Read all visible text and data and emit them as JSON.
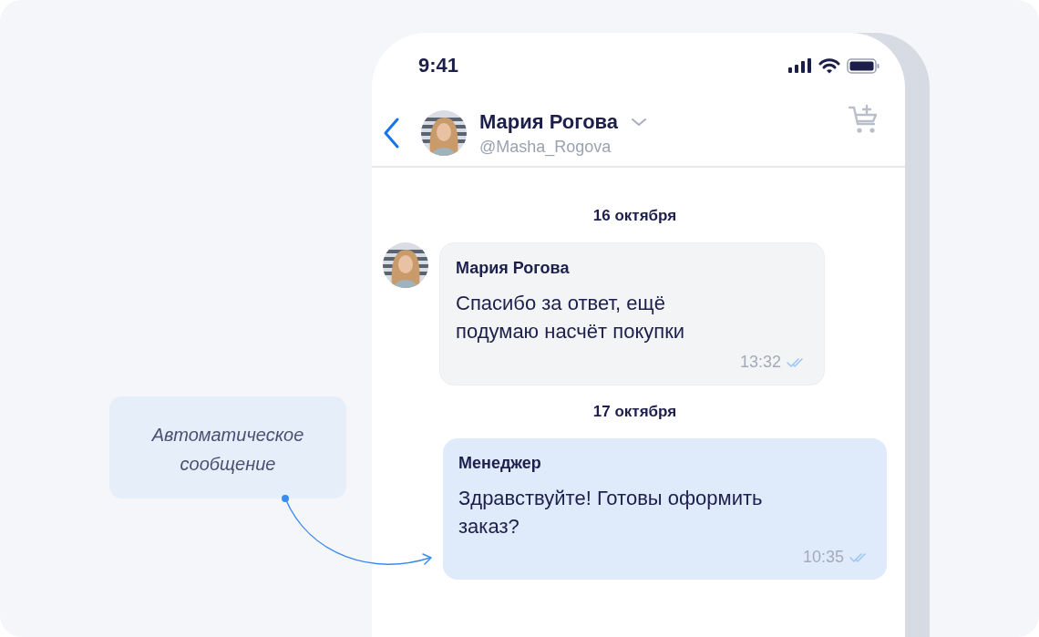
{
  "status_bar": {
    "time": "9:41"
  },
  "header": {
    "name": "Мария Рогова",
    "handle": "@Masha_Rogova"
  },
  "messages": [
    {
      "kind": "date",
      "text": "16 октября"
    },
    {
      "kind": "incoming",
      "sender": "Мария Рогова",
      "text": "Спасибо за ответ, ещё\nподумаю насчёт покупки",
      "time": "13:32",
      "read": true
    },
    {
      "kind": "date",
      "text": "17 октября"
    },
    {
      "kind": "outgoing",
      "sender": "Менеджер",
      "text": "Здравствуйте! Готовы оформить\nзаказ?",
      "time": "10:35",
      "read": true
    }
  ],
  "annotation": {
    "text": "Автоматическое\nсообщение"
  }
}
